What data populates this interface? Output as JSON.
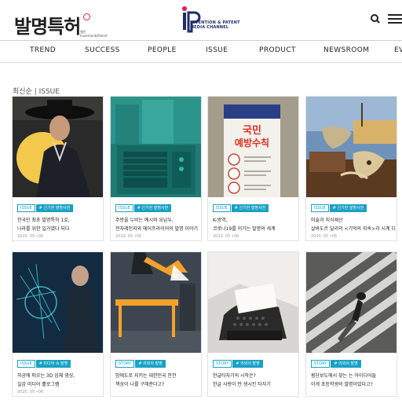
{
  "header": {
    "logo_text": "발명특허",
    "logo_sub_line1": "웹진",
    "logo_sub_line2": "Invention&Patent",
    "ip_line1": "INVENTION & PATENT",
    "ip_line2": "MEDIA CHANNEL",
    "search_icon": "search-icon",
    "menu_icon": "hamburger-menu-icon"
  },
  "nav": [
    "TREND",
    "SUCCESS",
    "PEOPLE",
    "ISSUE",
    "PRODUCT",
    "NEWSROOM",
    "EV"
  ],
  "breadcrumb": "최신순 | ISSUE",
  "colors": {
    "accent": "#19a1c4",
    "brand_pink": "#e51a5b",
    "brand_navy": "#1e2d6b"
  },
  "cards": [
    {
      "type": "ISSUE",
      "category": "# 신기한 발명사전",
      "title1": "한국인 최초 발명특허 1호,",
      "title2": "나라를 위한 일거였다 되다",
      "date": "2020. 05 •06"
    },
    {
      "type": "ISSUE",
      "category": "# 신기한 발명사전",
      "title1": "주방을 누비는 예시와 요납두,",
      "title2": "전자레인지와 에어프라이어의 발명 이야기",
      "date": "2020. 05 •06"
    },
    {
      "type": "ISSUE",
      "category": "# 신기한 발명사전",
      "title1": "K-방역,",
      "title2": "코로나19를 이기는 발명의 세계",
      "date": "2020. 05 •06",
      "poster_line1": "국민",
      "poster_line2": "예방수칙"
    },
    {
      "type": "ISSUE",
      "category": "# 신기한 발명사전",
      "title1": "미술과 지식재산",
      "title2": "살바도르 달리의 <기억의 지속>과 시계 디자인",
      "date": "2020. 05 •06"
    },
    {
      "type": "ISSUE",
      "category": "# 미디어 속 발명",
      "title1": "허공에 떠오는 3D 입체 영상,",
      "title2": "실감 미디어 홀로그램",
      "date": "2020. 05 •06"
    },
    {
      "type": "STORY",
      "category": "# 의외의 발명",
      "title1": "밤에도로 지키는 대한민국 안전",
      "title2": "책상이 나를 구해준다고?",
      "date": ""
    },
    {
      "type": "STORY",
      "category": "# 의외의 발명",
      "title1": "한글타자기의 시작은?",
      "title2": "한글 사랑이 만 생시킨 타자기",
      "date": ""
    },
    {
      "type": "STORY",
      "category": "# 의외의 발명",
      "title1": "횡단보도에서 찾는 는 아이디어들",
      "title2": "이게 초등학생의 발명이었다고?",
      "date": ""
    }
  ]
}
